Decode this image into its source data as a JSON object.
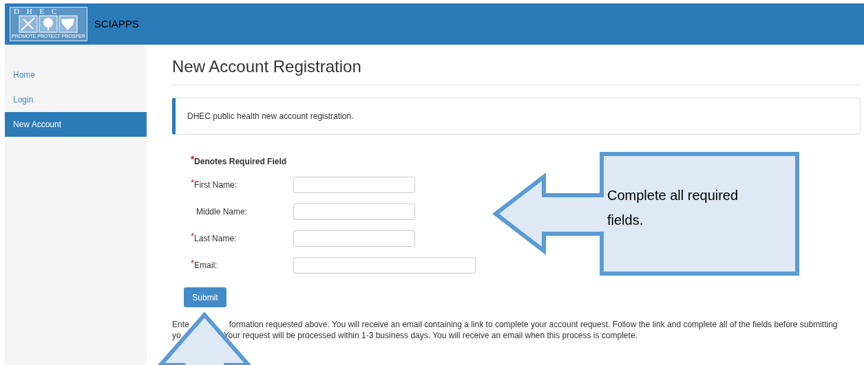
{
  "header": {
    "logo_letters": "D H E C",
    "logo_tagline": "PROMOTE PROTECT PROSPER",
    "app_name": "SCIAPPS"
  },
  "sidebar": {
    "items": [
      {
        "label": "Home",
        "selected": false
      },
      {
        "label": "Login",
        "selected": false
      },
      {
        "label": "New Account",
        "selected": true
      }
    ]
  },
  "page_title": "New Account Registration",
  "info_text": "DHEC public health new account registration.",
  "form": {
    "required_mark": "*",
    "required_note": "Denotes Required Field",
    "fields": [
      {
        "label": "First Name:",
        "required": true,
        "kind": "text"
      },
      {
        "label": "Middle Name:",
        "required": false,
        "kind": "text"
      },
      {
        "label": "Last Name:",
        "required": true,
        "kind": "text"
      },
      {
        "label": "Email:",
        "required": true,
        "kind": "email"
      }
    ],
    "submit": "Submit"
  },
  "instructions": {
    "line_1": [
      "Ente",
      "formation requested above. You will receive an email containing a link to complete your account request. Follow the link and complete all of the fields before submitting"
    ],
    "line_2": [
      "yo",
      "Your request will be processed within 1-3 business days. You will receive an email when this process is complete."
    ]
  },
  "callout": {
    "text": "Complete all required fields."
  }
}
